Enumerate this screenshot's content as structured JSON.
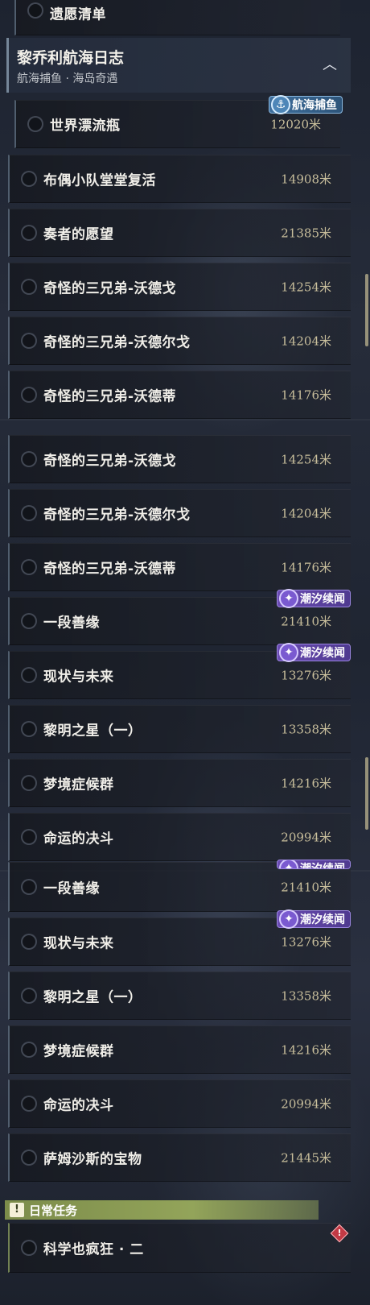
{
  "top_row": {
    "title": "遗愿清单"
  },
  "section_header": {
    "title": "黎乔利航海日志",
    "subtitle": "航海捕鱼 · 海岛奇遇",
    "collapse_icon": "chevron-up-icon"
  },
  "badges": {
    "blue": "航海捕鱼",
    "purple": "潮汐续闻"
  },
  "screen1": [
    {
      "title": "世界漂流瓶",
      "dist": "12020米"
    },
    {
      "title": "布偶小队堂堂复活",
      "dist": "14908米"
    },
    {
      "title": "奏者的愿望",
      "dist": "21385米"
    },
    {
      "title": "奇怪的三兄弟-沃德戈",
      "dist": "14254米"
    },
    {
      "title": "奇怪的三兄弟-沃德尔戈",
      "dist": "14204米"
    },
    {
      "title": "奇怪的三兄弟-沃德蒂",
      "dist": "14176米"
    }
  ],
  "screen2": [
    {
      "title": "奇怪的三兄弟-沃德戈",
      "dist": "14254米"
    },
    {
      "title": "奇怪的三兄弟-沃德尔戈",
      "dist": "14204米"
    },
    {
      "title": "奇怪的三兄弟-沃德蒂",
      "dist": "14176米"
    },
    {
      "title": "一段善缘",
      "dist": "21410米"
    },
    {
      "title": "现状与未来",
      "dist": "13276米"
    },
    {
      "title": "黎明之星（一）",
      "dist": "13358米"
    },
    {
      "title": "梦境症候群",
      "dist": "14216米"
    },
    {
      "title": "命运的决斗",
      "dist": "20994米"
    }
  ],
  "screen3": [
    {
      "title": "一段善缘",
      "dist": "21410米"
    },
    {
      "title": "现状与未来",
      "dist": "13276米"
    },
    {
      "title": "黎明之星（一）",
      "dist": "13358米"
    },
    {
      "title": "梦境症候群",
      "dist": "14216米"
    },
    {
      "title": "命运的决斗",
      "dist": "20994米"
    },
    {
      "title": "萨姆沙斯的宝物",
      "dist": "21445米"
    }
  ],
  "daily": {
    "header": "日常任务",
    "icon_glyph": "!",
    "task": "科学也疯狂 · 二",
    "alert_glyph": "!"
  }
}
